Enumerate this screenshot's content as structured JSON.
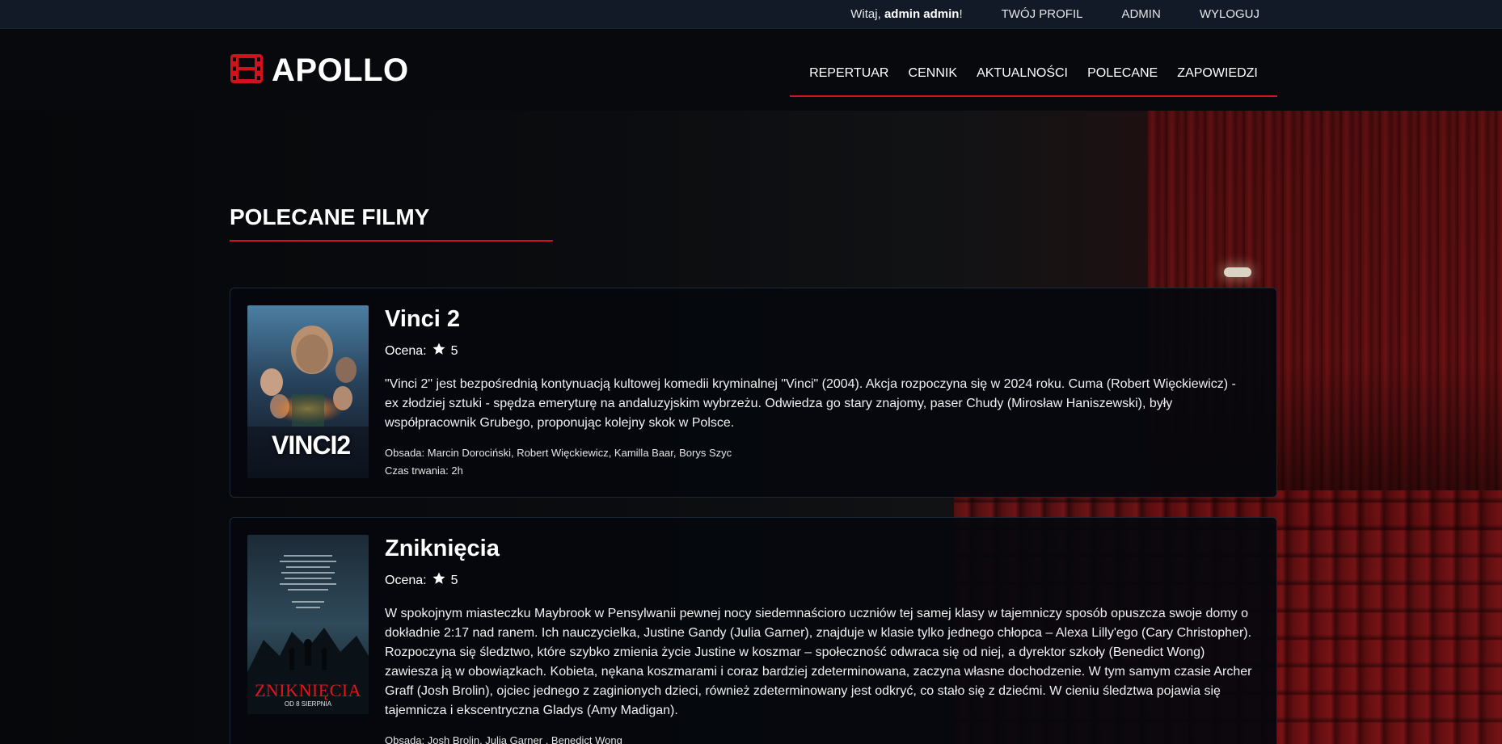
{
  "topbar": {
    "greeting_prefix": "Witaj,",
    "username": "admin admin",
    "greeting_suffix": "!",
    "links": [
      "TWÓJ PROFIL",
      "ADMIN",
      "WYLOGUJ"
    ]
  },
  "header": {
    "logo_icon": "film-icon",
    "logo_text": "APOLLO",
    "nav": [
      "REPERTUAR",
      "CENNIK",
      "AKTUALNOŚCI",
      "POLECANE",
      "ZAPOWIEDZI"
    ]
  },
  "colors": {
    "accent": "#d0121b",
    "background": "#06080c",
    "topbar": "#111a26",
    "card_border": "#1b2a3a"
  },
  "section": {
    "title": "POLECANE FILMY"
  },
  "movies": [
    {
      "title": "Vinci 2",
      "rating_label": "Ocena:",
      "rating_icon": "star-icon",
      "rating_value": "5",
      "description": "\"Vinci 2\" jest bezpośrednią kontynuacją kultowej komedii kryminalnej \"Vinci\" (2004). Akcja rozpoczyna się w 2024 roku. Cuma (Robert Więckiewicz) - ex złodziej sztuki - spędza emeryturę na andaluzyjskim wybrzeżu. Odwiedza go stary znajomy, paser Chudy (Mirosław Haniszewski), były współpracownik Grubego, proponując kolejny skok w Polsce.",
      "cast": "Obsada: Marcin Dorociński, Robert Więckiewicz, Kamilla Baar, Borys Szyc",
      "duration": "Czas trwania: 2h",
      "poster_text": "VINCI2"
    },
    {
      "title": "Zniknięcia",
      "rating_label": "Ocena:",
      "rating_icon": "star-icon",
      "rating_value": "5",
      "description": "W spokojnym miasteczku Maybrook w Pensylwanii pewnej nocy siedemnaścioro uczniów tej samej klasy w tajemniczy sposób opuszcza swoje domy o dokładnie 2:17 nad ranem. Ich nauczycielka, Justine Gandy (Julia Garner), znajduje w klasie tylko jednego chłopca – Alexa Lilly'ego (Cary Christopher). Rozpoczyna się śledztwo, które szybko zmienia życie Justine w koszmar – społeczność odwraca się od niej, a dyrektor szkoły (Benedict Wong) zawiesza ją w obowiązkach. Kobieta, nękana koszmarami i coraz bardziej zdeterminowana, zaczyna własne dochodzenie. W tym samym czasie Archer Graff (Josh Brolin), ojciec jednego z zaginionych dzieci, również zdeterminowany jest odkryć, co stało się z dziećmi. W cieniu śledztwa pojawia się tajemnicza i ekscentryczna Gladys (Amy Madigan).",
      "cast": "Obsada: Josh Brolin, Julia Garner , Benedict Wong",
      "poster_text": "ZNIKNIĘCIA",
      "poster_subtext": "OD 8 SIERPNIA"
    }
  ]
}
